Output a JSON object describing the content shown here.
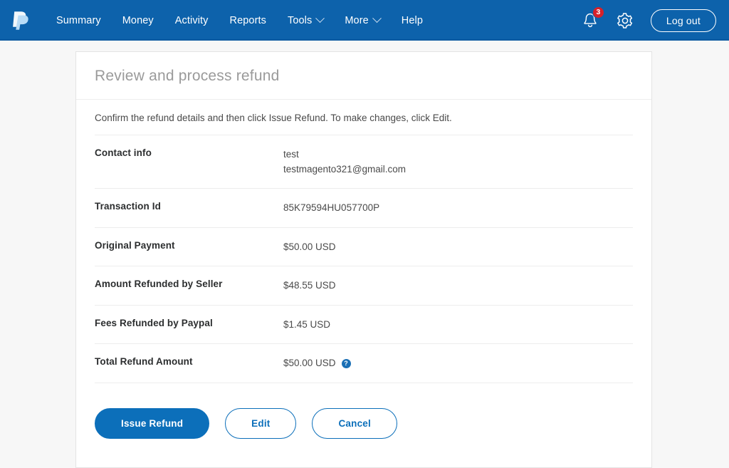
{
  "header": {
    "brand_icon": "paypal-logo-icon",
    "nav": [
      {
        "label": "Summary",
        "has_caret": false
      },
      {
        "label": "Money",
        "has_caret": false
      },
      {
        "label": "Activity",
        "has_caret": false
      },
      {
        "label": "Reports",
        "has_caret": false
      },
      {
        "label": "Tools",
        "has_caret": true
      },
      {
        "label": "More",
        "has_caret": true
      },
      {
        "label": "Help",
        "has_caret": false
      }
    ],
    "notifications": {
      "icon": "bell-icon",
      "count": "3"
    },
    "settings_icon": "gear-icon",
    "logout_label": "Log out",
    "background_color": "#0d62ab"
  },
  "card": {
    "title": "Review and process refund",
    "intro": "Confirm the refund details and then click Issue Refund. To make changes, click Edit.",
    "rows": [
      {
        "label": "Contact info",
        "value_lines": [
          "test",
          "testmagento321@gmail.com"
        ]
      },
      {
        "label": "Transaction Id",
        "value_lines": [
          "85K79594HU057700P"
        ]
      },
      {
        "label": "Original Payment",
        "value_lines": [
          "$50.00 USD"
        ]
      },
      {
        "label": "Amount Refunded by Seller",
        "value_lines": [
          "$48.55 USD"
        ]
      },
      {
        "label": "Fees Refunded by Paypal",
        "value_lines": [
          "$1.45 USD"
        ]
      },
      {
        "label": "Total Refund Amount",
        "value_lines": [
          "$50.00 USD"
        ],
        "help_icon": "?"
      }
    ],
    "actions": {
      "primary_label": "Issue Refund",
      "edit_label": "Edit",
      "cancel_label": "Cancel"
    }
  },
  "colors": {
    "header_blue": "#0d62ab",
    "accent_blue": "#0c6fba",
    "badge_red": "#d6212a",
    "page_background": "#f7f7f7"
  }
}
